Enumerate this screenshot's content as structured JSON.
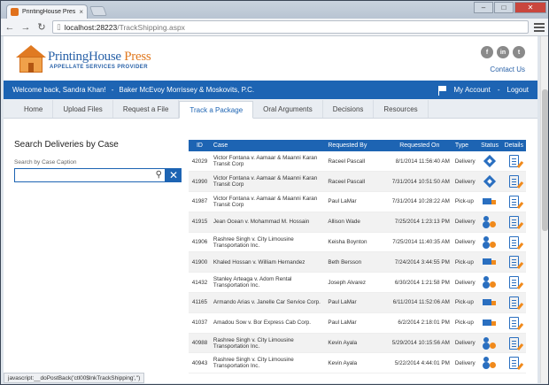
{
  "browser": {
    "tab_title": "PrintingHouse Press",
    "url_host": "localhost:28223",
    "url_path": "/TrackShipping.aspx",
    "status_text": "javascript:__doPostBack('ctl00$lnkTrackShipping','')"
  },
  "header": {
    "logo_main": "PrintingHouse",
    "logo_accent": "Press",
    "logo_sub": "APPELLATE SERVICES PROVIDER",
    "social": [
      "f",
      "in",
      "t"
    ],
    "contact_label": "Contact Us"
  },
  "userbar": {
    "welcome": "Welcome back, Sandra Khan!",
    "firm": "Baker McEvoy Morrissey & Moskovits, P.C.",
    "account_label": "My Account",
    "logout_label": "Logout"
  },
  "nav": {
    "tabs": [
      "Home",
      "Upload Files",
      "Request a File",
      "Track a Package",
      "Oral Arguments",
      "Decisions",
      "Resources"
    ],
    "active": "Track a Package"
  },
  "search": {
    "title": "Search Deliveries by Case",
    "label": "Search by Case Caption",
    "value": ""
  },
  "table": {
    "columns": [
      "ID",
      "Case",
      "Requested By",
      "Requested On",
      "Type",
      "Status",
      "Details"
    ],
    "rows": [
      {
        "id": "42029",
        "case": "Victor Fontana v. Aamaar & Maanni Karan Transit Corp",
        "by": "Raceel Pascall",
        "on": "8/1/2014 11:56:40 AM",
        "type": "Delivery",
        "status": "box-icon"
      },
      {
        "id": "41990",
        "case": "Victor Fontana v. Aamaar & Maanni Karan Transit Corp",
        "by": "Raceel Pascall",
        "on": "7/31/2014 10:51:50 AM",
        "type": "Delivery",
        "status": "box-icon"
      },
      {
        "id": "41987",
        "case": "Victor Fontana v. Aamaar & Maanni Karan Transit Corp",
        "by": "Paul LaMar",
        "on": "7/31/2014 10:28:22 AM",
        "type": "Pick-up",
        "status": "truck-icon"
      },
      {
        "id": "41915",
        "case": "Jean Ocean v. Mohammad M. Hossain",
        "by": "Allison Wade",
        "on": "7/25/2014 1:23:13 PM",
        "type": "Delivery",
        "status": "person-icon"
      },
      {
        "id": "41906",
        "case": "Rashree Singh v. City Limousine Transportation Inc.",
        "by": "Keisha Boynton",
        "on": "7/25/2014 11:40:35 AM",
        "type": "Delivery",
        "status": "person-icon"
      },
      {
        "id": "41900",
        "case": "Khaled Hossan v. William Hernandez",
        "by": "Beth Bersson",
        "on": "7/24/2014 3:44:55 PM",
        "type": "Pick-up",
        "status": "truck-icon"
      },
      {
        "id": "41432",
        "case": "Stanley Arteaga v. Adom Rental Transportation Inc.",
        "by": "Joseph Alvarez",
        "on": "6/30/2014 1:21:58 PM",
        "type": "Delivery",
        "status": "person-icon"
      },
      {
        "id": "41165",
        "case": "Armando Arias v. Janelle Car Service Corp.",
        "by": "Paul LaMar",
        "on": "6/11/2014 11:52:06 AM",
        "type": "Pick-up",
        "status": "truck-icon"
      },
      {
        "id": "41037",
        "case": "Amadou Sow v. Bor Express Cab Corp.",
        "by": "Paul LaMar",
        "on": "6/2/2014 2:18:01 PM",
        "type": "Pick-up",
        "status": "truck-icon"
      },
      {
        "id": "40988",
        "case": "Rashree Singh v. City Limousine Transportation Inc.",
        "by": "Kevin Ayala",
        "on": "5/29/2014 10:15:56 AM",
        "type": "Delivery",
        "status": "person-icon"
      },
      {
        "id": "40943",
        "case": "Rashree Singh v. City Limousine Transportation Inc.",
        "by": "Kevin Ayala",
        "on": "5/22/2014 4:44:01 PM",
        "type": "Delivery",
        "status": "person-icon"
      }
    ]
  }
}
